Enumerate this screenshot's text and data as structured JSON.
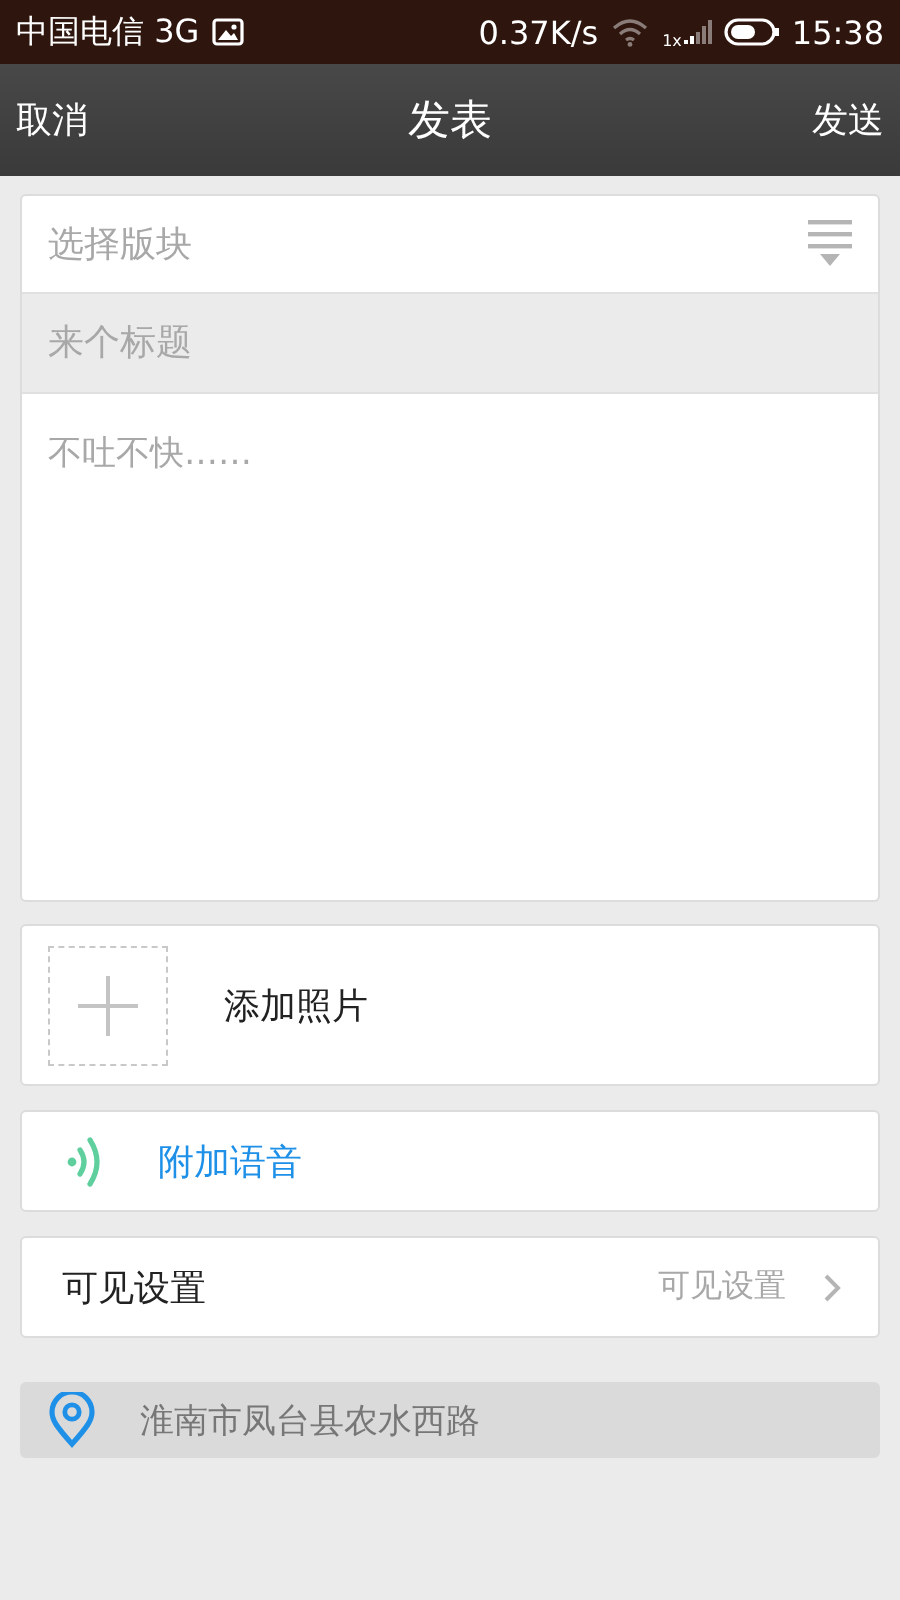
{
  "status_bar": {
    "carrier": "中国电信 3G",
    "speed": "0.37K/s",
    "signal_label": "1x",
    "time": "15:38"
  },
  "nav_bar": {
    "left": "取消",
    "title": "发表",
    "right": "发送"
  },
  "form": {
    "board": {
      "placeholder": "选择版块"
    },
    "title": {
      "placeholder": "来个标题"
    },
    "body": {
      "placeholder": "不吐不快……"
    }
  },
  "photo": {
    "label": "添加照片"
  },
  "voice": {
    "label": "附加语音"
  },
  "visibility": {
    "label": "可见设置",
    "value": "可见设置"
  },
  "location": {
    "text": "淮南市凤台县农水西路"
  }
}
